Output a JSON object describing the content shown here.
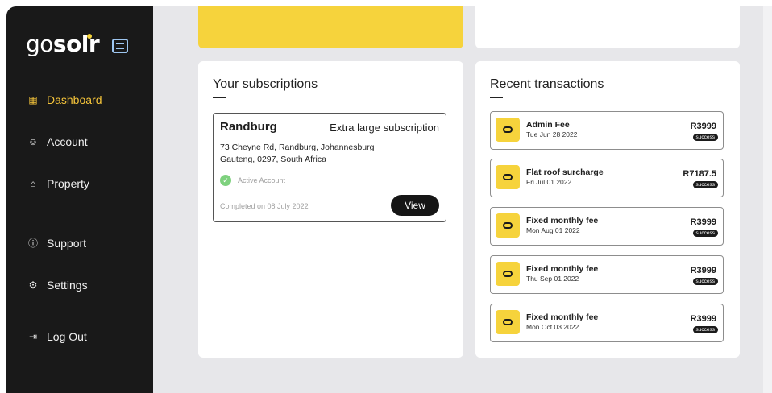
{
  "app": {
    "logo_prefix": "go",
    "logo_suffix": "solr",
    "accent_color": "#f6d33c",
    "sidebar_color": "#191919"
  },
  "sidebar": {
    "items": [
      {
        "label": "Dashboard",
        "icon": "grid-icon",
        "active": true
      },
      {
        "label": "Account",
        "icon": "user-icon",
        "active": false
      },
      {
        "label": "Property",
        "icon": "home-icon",
        "active": false
      },
      {
        "label": "Support",
        "icon": "help-icon",
        "active": false
      },
      {
        "label": "Settings",
        "icon": "gear-icon",
        "active": false
      },
      {
        "label": "Log Out",
        "icon": "logout-icon",
        "active": false
      }
    ]
  },
  "subscriptions": {
    "title": "Your subscriptions",
    "card": {
      "city": "Randburg",
      "plan": "Extra large subscription",
      "address_line1": "73 Cheyne Rd, Randburg, Johannesburg",
      "address_line2": "Gauteng, 0297, South Africa",
      "status": "Active Account",
      "completed": "Completed on 08 July 2022",
      "view_label": "View"
    }
  },
  "transactions": {
    "title": "Recent transactions",
    "items": [
      {
        "title": "Admin Fee",
        "date": "Tue Jun 28 2022",
        "amount": "R3999",
        "status": "success"
      },
      {
        "title": "Flat roof surcharge",
        "date": "Fri Jul 01 2022",
        "amount": "R7187.5",
        "status": "success"
      },
      {
        "title": "Fixed monthly fee",
        "date": "Mon Aug 01 2022",
        "amount": "R3999",
        "status": "success"
      },
      {
        "title": "Fixed monthly fee",
        "date": "Thu Sep 01 2022",
        "amount": "R3999",
        "status": "success"
      },
      {
        "title": "Fixed monthly fee",
        "date": "Mon Oct 03 2022",
        "amount": "R3999",
        "status": "success"
      }
    ]
  }
}
